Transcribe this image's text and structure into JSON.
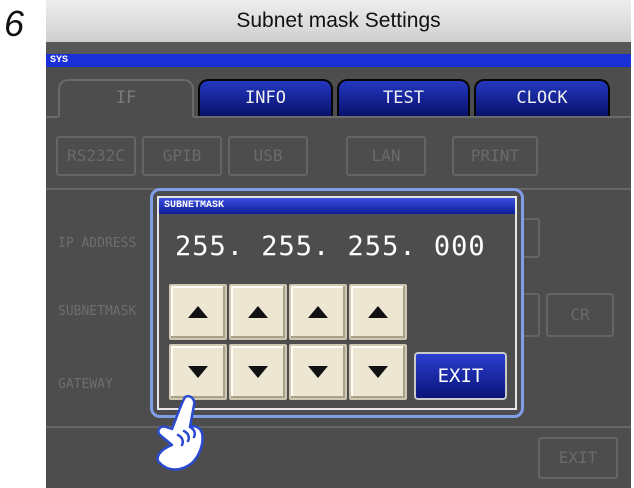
{
  "step": {
    "number": "6",
    "title": "Subnet mask Settings"
  },
  "sys_label": "SYS",
  "tabs": [
    {
      "label": "IF",
      "active": true
    },
    {
      "label": "INFO",
      "active": false
    },
    {
      "label": "TEST",
      "active": false
    },
    {
      "label": "CLOCK",
      "active": false
    }
  ],
  "interfaces": [
    "RS232C",
    "GPIB",
    "USB",
    "LAN",
    "PRINT"
  ],
  "background_labels": {
    "ip_address": "IP ADDRESS",
    "subnetmask": "SUBNETMASK",
    "gateway": "GATEWAY",
    "cr": "CR",
    "exit": "EXIT"
  },
  "dialog": {
    "title": "SUBNETMASK",
    "value": "255. 255. 255. 000",
    "exit_label": "EXIT"
  },
  "icons": {
    "up": "triangle-up-icon",
    "down": "triangle-down-icon",
    "hand": "pointing-hand-icon"
  },
  "colors": {
    "screen_bg": "#4d4d4d",
    "blue_accent": "#1a2fd6",
    "button_face": "#ede6d2"
  }
}
